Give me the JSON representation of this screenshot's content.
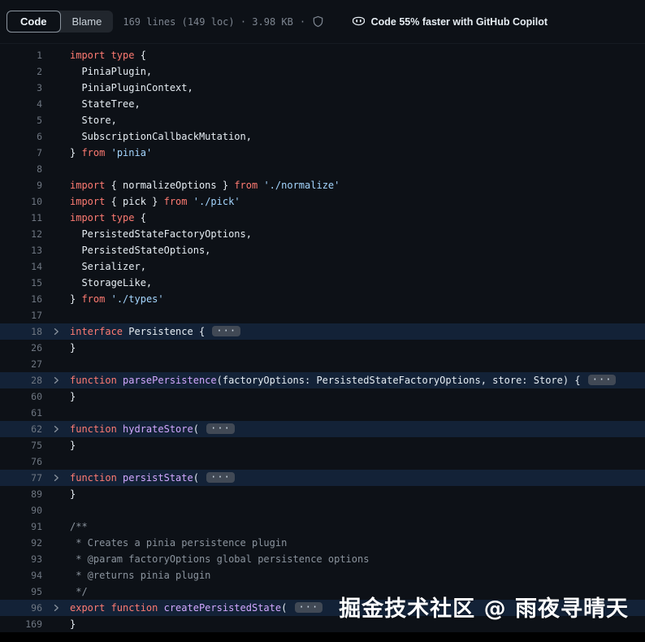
{
  "toolbar": {
    "code_tab": "Code",
    "blame_tab": "Blame",
    "file_meta": "169 lines (149 loc) · 3.98 KB",
    "separator": "·",
    "copilot_text": "Code 55% faster with GitHub Copilot"
  },
  "watermark": "掘金技术社区 @ 雨夜寻晴天",
  "colors": {
    "background": "#0d1117",
    "keyword": "#ff7b72",
    "string": "#a5d6ff",
    "function_name": "#d2a8ff",
    "plain_text": "#e6edf3",
    "comment": "#8b949e",
    "line_number": "#6e7681",
    "highlight_row": "rgba(56,139,253,0.14)",
    "badge_bg": "#414955"
  },
  "code": {
    "ellipsis": "···",
    "lines": [
      {
        "n": "1",
        "t": [
          [
            "k",
            "import type"
          ],
          [
            "p",
            " {"
          ]
        ]
      },
      {
        "n": "2",
        "t": [
          [
            "p",
            "  PiniaPlugin,"
          ]
        ]
      },
      {
        "n": "3",
        "t": [
          [
            "p",
            "  PiniaPluginContext,"
          ]
        ]
      },
      {
        "n": "4",
        "t": [
          [
            "p",
            "  StateTree,"
          ]
        ]
      },
      {
        "n": "5",
        "t": [
          [
            "p",
            "  Store,"
          ]
        ]
      },
      {
        "n": "6",
        "t": [
          [
            "p",
            "  SubscriptionCallbackMutation,"
          ]
        ]
      },
      {
        "n": "7",
        "t": [
          [
            "p",
            "} "
          ],
          [
            "k",
            "from"
          ],
          [
            "p",
            " "
          ],
          [
            "s",
            "'pinia'"
          ]
        ]
      },
      {
        "n": "8",
        "t": []
      },
      {
        "n": "9",
        "t": [
          [
            "k",
            "import"
          ],
          [
            "p",
            " { normalizeOptions } "
          ],
          [
            "k",
            "from"
          ],
          [
            "p",
            " "
          ],
          [
            "s",
            "'./normalize'"
          ]
        ]
      },
      {
        "n": "10",
        "t": [
          [
            "k",
            "import"
          ],
          [
            "p",
            " { pick } "
          ],
          [
            "k",
            "from"
          ],
          [
            "p",
            " "
          ],
          [
            "s",
            "'./pick'"
          ]
        ]
      },
      {
        "n": "11",
        "t": [
          [
            "k",
            "import type"
          ],
          [
            "p",
            " {"
          ]
        ]
      },
      {
        "n": "12",
        "t": [
          [
            "p",
            "  PersistedStateFactoryOptions,"
          ]
        ]
      },
      {
        "n": "13",
        "t": [
          [
            "p",
            "  PersistedStateOptions,"
          ]
        ]
      },
      {
        "n": "14",
        "t": [
          [
            "p",
            "  Serializer,"
          ]
        ]
      },
      {
        "n": "15",
        "t": [
          [
            "p",
            "  StorageLike,"
          ]
        ]
      },
      {
        "n": "16",
        "t": [
          [
            "p",
            "} "
          ],
          [
            "k",
            "from"
          ],
          [
            "p",
            " "
          ],
          [
            "s",
            "'./types'"
          ]
        ]
      },
      {
        "n": "17",
        "t": []
      },
      {
        "n": "18",
        "t": [
          [
            "k",
            "interface"
          ],
          [
            "p",
            " Persistence { "
          ]
        ],
        "hl": true,
        "ch": true,
        "col": true
      },
      {
        "n": "26",
        "t": [
          [
            "p",
            "}"
          ]
        ]
      },
      {
        "n": "27",
        "t": []
      },
      {
        "n": "28",
        "t": [
          [
            "k",
            "function"
          ],
          [
            "f",
            " parsePersistence"
          ],
          [
            "p",
            "(factoryOptions: PersistedStateFactoryOptions, store: Store) { "
          ]
        ],
        "hl": true,
        "ch": true,
        "col": true
      },
      {
        "n": "60",
        "t": [
          [
            "p",
            "}"
          ]
        ]
      },
      {
        "n": "61",
        "t": []
      },
      {
        "n": "62",
        "t": [
          [
            "k",
            "function"
          ],
          [
            "f",
            " hydrateStore"
          ],
          [
            "p",
            "( "
          ]
        ],
        "hl": true,
        "ch": true,
        "col": true
      },
      {
        "n": "75",
        "t": [
          [
            "p",
            "}"
          ]
        ]
      },
      {
        "n": "76",
        "t": []
      },
      {
        "n": "77",
        "t": [
          [
            "k",
            "function"
          ],
          [
            "f",
            " persistState"
          ],
          [
            "p",
            "( "
          ]
        ],
        "hl": true,
        "ch": true,
        "col": true
      },
      {
        "n": "89",
        "t": [
          [
            "p",
            "}"
          ]
        ]
      },
      {
        "n": "90",
        "t": []
      },
      {
        "n": "91",
        "t": [
          [
            "c",
            "/**"
          ]
        ]
      },
      {
        "n": "92",
        "t": [
          [
            "c",
            " * Creates a pinia persistence plugin"
          ]
        ]
      },
      {
        "n": "93",
        "t": [
          [
            "c",
            " * @param factoryOptions global persistence options"
          ]
        ]
      },
      {
        "n": "94",
        "t": [
          [
            "c",
            " * @returns pinia plugin"
          ]
        ]
      },
      {
        "n": "95",
        "t": [
          [
            "c",
            " */"
          ]
        ]
      },
      {
        "n": "96",
        "t": [
          [
            "k",
            "export function"
          ],
          [
            "f",
            " createPersistedState"
          ],
          [
            "p",
            "( "
          ]
        ],
        "hl": true,
        "ch": true,
        "col": true
      },
      {
        "n": "169",
        "t": [
          [
            "p",
            "}"
          ]
        ]
      }
    ]
  }
}
